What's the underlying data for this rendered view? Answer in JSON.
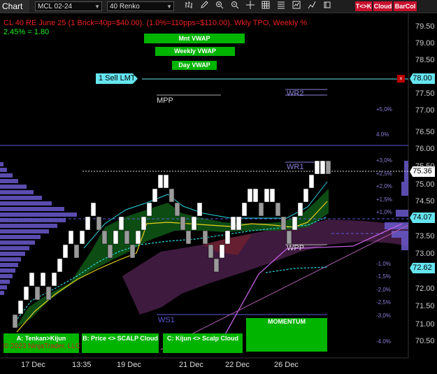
{
  "toolbar": {
    "title": "Chart",
    "instrument": "MCL 02-24",
    "bar_type": "40 Renko",
    "btn_tk": "T<>K",
    "btn_cloud": "Cloud",
    "btn_barcol": "BarCol"
  },
  "indicators": {
    "mnt_vwap": "Mnt VWAP",
    "weekly_vwap": "Weekly VWAP",
    "day_vwap": "Day VWAP"
  },
  "header": {
    "title": "CL 40 RE June 25 (1 Brick=40p=$40.00). (1.0%=110pps=$110.00). Wkly TPO, Weekly %",
    "subtitle": "2.45% = 1.80"
  },
  "order": {
    "label": "1 Sell LMT",
    "price": "78.00",
    "close": "×"
  },
  "levels": {
    "mpp": "MPP",
    "wr2": "WR2",
    "wr1": "WR1",
    "wpp": "WPP",
    "ws1": "WS1"
  },
  "percent_labels": [
    "+5,0%",
    "4.0%",
    "+3,0%",
    "+2,5%",
    "+2,0%",
    "+1,5%",
    "+1,0%",
    "-1.0%",
    "-1,5%",
    "-2,0%",
    "-2,5%",
    "-3,0%",
    "-4.0%"
  ],
  "price_badges": {
    "last": "75.36",
    "mid": "74.07",
    "low": "72.62"
  },
  "price_axis": [
    "79.50",
    "79.00",
    "78.50",
    "77.50",
    "77.00",
    "76.50",
    "76.00",
    "75.50",
    "75.00",
    "74.50",
    "73.50",
    "73.00",
    "72.00",
    "71.50",
    "71.00",
    "70.50"
  ],
  "date_axis": [
    "17 Dec",
    "13:35",
    "19 Dec",
    "21 Dec",
    "22 Dec",
    "26 Dec"
  ],
  "bottom_buttons": {
    "tk": "A: Tenkan>Kijun",
    "price_scalp": "B: Price <> SCALP Cloud",
    "kijun_scalp": "C: Kijun <> Scalp Cloud",
    "momentum": "MOMENTUM"
  },
  "copyright": "© 2023 NinjaTrader, LLC",
  "colors": {
    "background": "#000000",
    "accent_green": "#00b400",
    "title_red": "#e22222",
    "cyan": "#66e5f0",
    "profile": "#6a5acd"
  },
  "icons": [
    "dropdown-arrow-icon",
    "bar-chart-icon",
    "pencil-icon",
    "zoom-in-icon",
    "zoom-out-icon",
    "crosshair-icon",
    "grid-icon",
    "list-icon",
    "chart-trader-icon",
    "line-chart-icon",
    "template-icon"
  ]
}
